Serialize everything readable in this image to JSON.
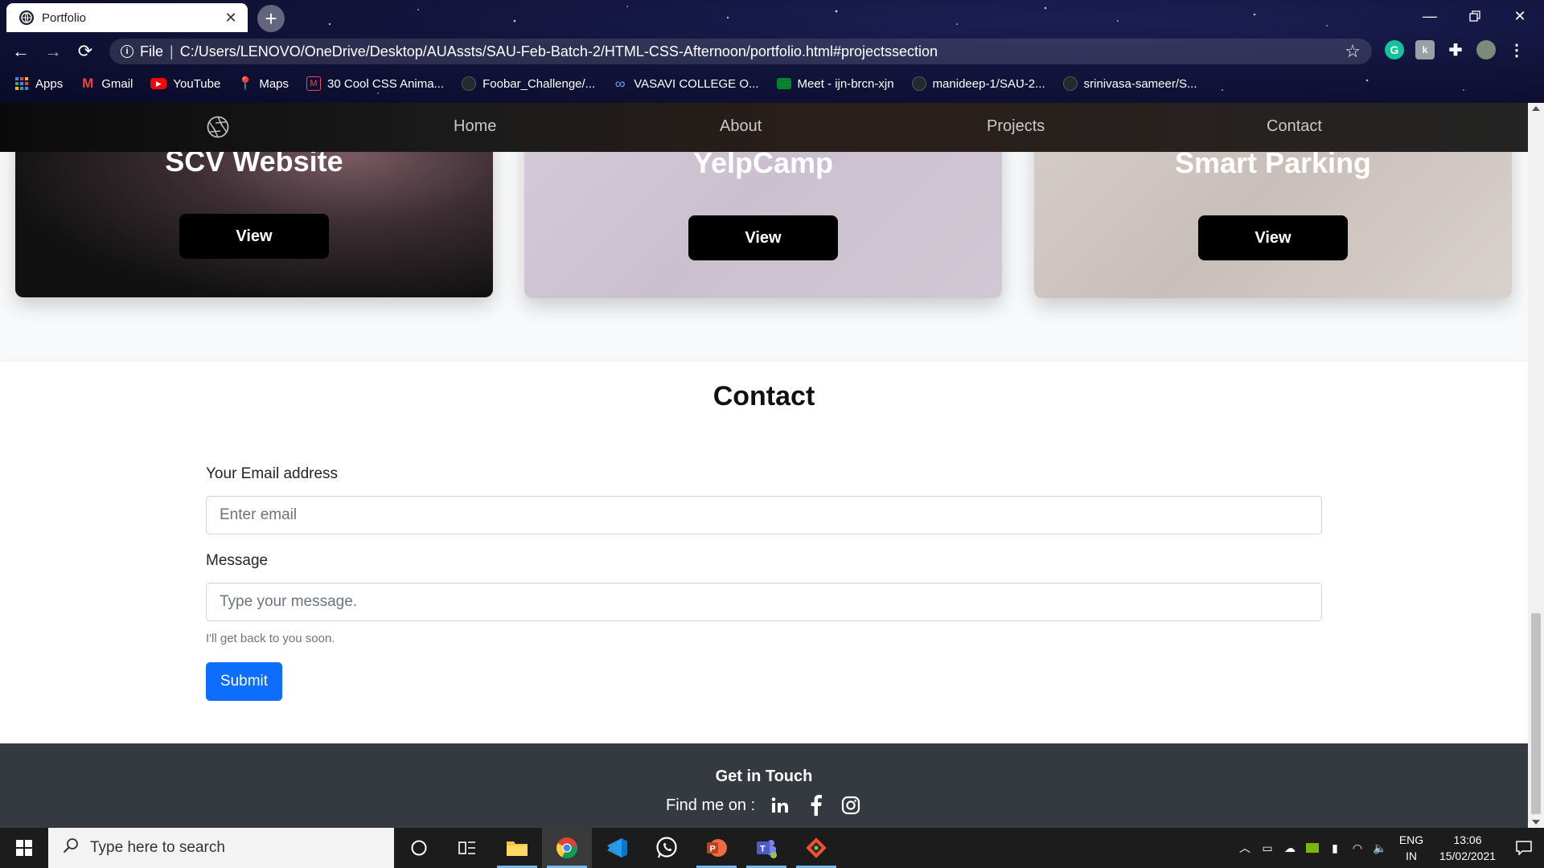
{
  "browser": {
    "tab_title": "Portfolio",
    "url_scheme": "File",
    "url": "C:/Users/LENOVO/OneDrive/Desktop/AUAssts/SAU-Feb-Batch-2/HTML-CSS-Afternoon/portfolio.html#projectssection",
    "bookmarks": [
      {
        "label": "Apps",
        "icon": "apps-grid-icon"
      },
      {
        "label": "Gmail",
        "icon": "gmail-icon"
      },
      {
        "label": "YouTube",
        "icon": "youtube-icon"
      },
      {
        "label": "Maps",
        "icon": "maps-icon"
      },
      {
        "label": "30 Cool CSS Anima...",
        "icon": "mail-icon"
      },
      {
        "label": "Foobar_Challenge/...",
        "icon": "github-icon"
      },
      {
        "label": "VASAVI COLLEGE O...",
        "icon": "link-icon"
      },
      {
        "label": "Meet - ijn-brcn-xjn",
        "icon": "meet-icon"
      },
      {
        "label": "manideep-1/SAU-2...",
        "icon": "github-icon"
      },
      {
        "label": "srinivasa-sameer/S...",
        "icon": "github-icon"
      }
    ]
  },
  "site": {
    "nav": {
      "links": [
        "Home",
        "About",
        "Projects",
        "Contact"
      ]
    },
    "projects": [
      {
        "title": "SCV Website",
        "button": "View"
      },
      {
        "title": "YelpCamp",
        "button": "View"
      },
      {
        "title": "Smart Parking",
        "button": "View"
      }
    ],
    "contact": {
      "heading": "Contact",
      "email_label": "Your Email address",
      "email_placeholder": "Enter email",
      "message_label": "Message",
      "message_placeholder": "Type your message.",
      "hint": "I'll get back to you soon.",
      "submit": "Submit"
    },
    "footer": {
      "title": "Get in Touch",
      "find_me": "Find me on :",
      "socials": [
        "linkedin-icon",
        "facebook-icon",
        "instagram-icon"
      ]
    }
  },
  "taskbar": {
    "search_placeholder": "Type here to search",
    "lang_top": "ENG",
    "lang_bottom": "IN",
    "time": "13:06",
    "date": "15/02/2021"
  },
  "colors": {
    "primary_button": "#0d6efd",
    "footer_bg": "#343a40",
    "nav_bg": "#202020"
  }
}
